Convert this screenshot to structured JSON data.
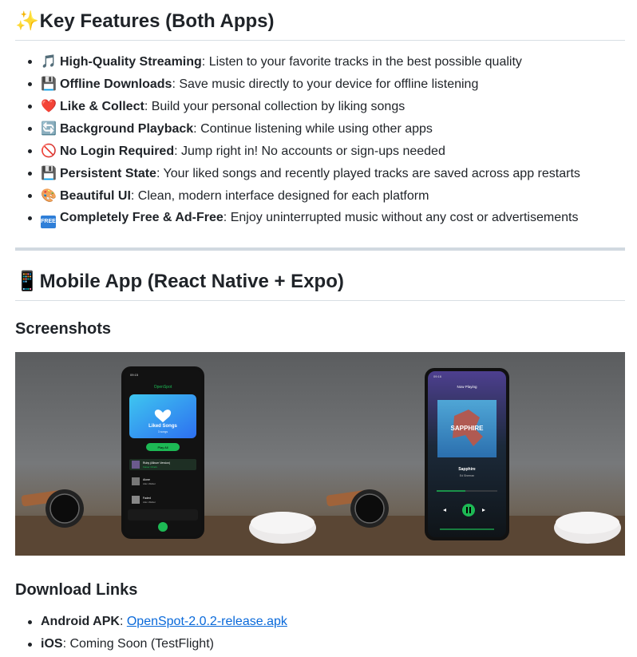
{
  "features": {
    "heading_icon": "sparkles-icon",
    "heading": "Key Features (Both Apps)",
    "items": [
      {
        "icon": "music-note-icon",
        "glyph": "🎵",
        "title": "High-Quality Streaming",
        "desc": ": Listen to your favorite tracks in the best possible quality"
      },
      {
        "icon": "floppy-disk-icon",
        "glyph": "💾",
        "title": "Offline Downloads",
        "desc": ": Save music directly to your device for offline listening"
      },
      {
        "icon": "heart-icon",
        "glyph": "❤️",
        "title": "Like & Collect",
        "desc": ": Build your personal collection by liking songs"
      },
      {
        "icon": "repeat-icon",
        "glyph": "🔄",
        "title": "Background Playback",
        "desc": ": Continue listening while using other apps"
      },
      {
        "icon": "prohibited-icon",
        "glyph": "🚫",
        "title": "No Login Required",
        "desc": ": Jump right in! No accounts or sign-ups needed"
      },
      {
        "icon": "floppy-disk-icon",
        "glyph": "💾",
        "title": "Persistent State",
        "desc": ": Your liked songs and recently played tracks are saved across app restarts"
      },
      {
        "icon": "palette-icon",
        "glyph": "🎨",
        "title": "Beautiful UI",
        "desc": ": Clean, modern interface designed for each platform"
      },
      {
        "icon": "free-badge-icon",
        "glyph": "FREE",
        "title": "Completely Free & Ad-Free",
        "desc": ": Enjoy uninterrupted music without any cost or advertisements"
      }
    ]
  },
  "mobile": {
    "heading_icon": "mobile-phone-icon",
    "heading": "Mobile App (React Native + Expo)",
    "screenshots_heading": "Screenshots",
    "screenshots": [
      {
        "app_name": "OpenSpot",
        "card_title": "Liked Songs",
        "card_sub": "3 songs",
        "play_all": "Play All",
        "tracks": [
          {
            "title": "Ruby (Album Version)",
            "artist": "Kaiser Chiefs"
          },
          {
            "title": "Alone",
            "artist": "Alan Walker"
          },
          {
            "title": "Faded",
            "artist": "Alan Walker"
          }
        ]
      },
      {
        "header": "Now Playing",
        "album_text": "SAPPHIRE",
        "song": "Sapphire",
        "artist": "Ed Sheeran"
      }
    ]
  },
  "downloads": {
    "heading": "Download Links",
    "items": [
      {
        "label": "Android APK",
        "sep": ": ",
        "link": "OpenSpot-2.0.2-release.apk"
      },
      {
        "label": "iOS",
        "value": ": Coming Soon (TestFlight)"
      }
    ]
  },
  "colors": {
    "accent_green": "#1db954",
    "link_blue": "#0969da",
    "heading_text": "#1f2328"
  }
}
